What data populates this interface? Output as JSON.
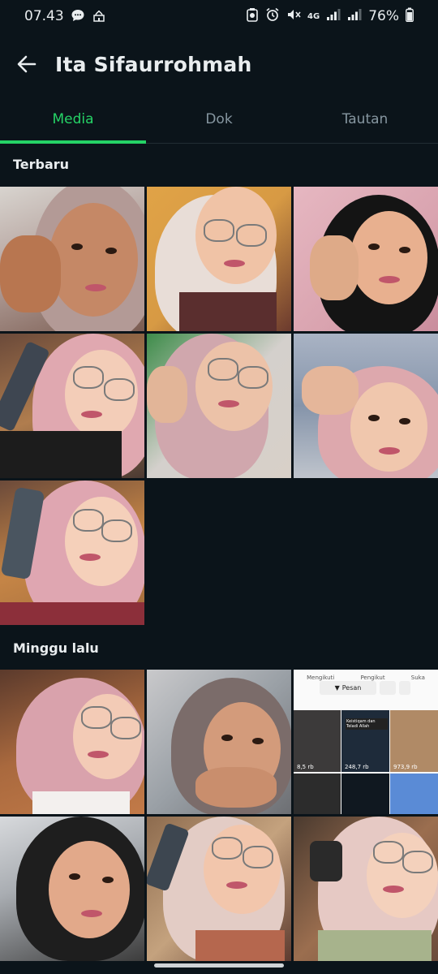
{
  "status": {
    "time": "07.43",
    "network": "4G",
    "battery": "76%"
  },
  "header": {
    "title": "Ita Sifaurrohmah"
  },
  "tabs": [
    {
      "label": "Media",
      "active": true
    },
    {
      "label": "Dok",
      "active": false
    },
    {
      "label": "Tautan",
      "active": false
    }
  ],
  "sections": [
    {
      "label": "Terbaru",
      "item_count": 7
    },
    {
      "label": "Minggu lalu",
      "item_count": 6
    }
  ],
  "screenshot_tile": {
    "stats": [
      "Mengikuti",
      "Pengikut",
      "Suka"
    ],
    "message_button": "Pesan",
    "video_caption": "Keistiqam dan Teladi Allah",
    "views": [
      "8,5 rb",
      "248,7 rb",
      "973,9 rb"
    ]
  },
  "colors": {
    "background": "#0b141a",
    "accent": "#25d366",
    "muted_text": "#8696a0"
  }
}
